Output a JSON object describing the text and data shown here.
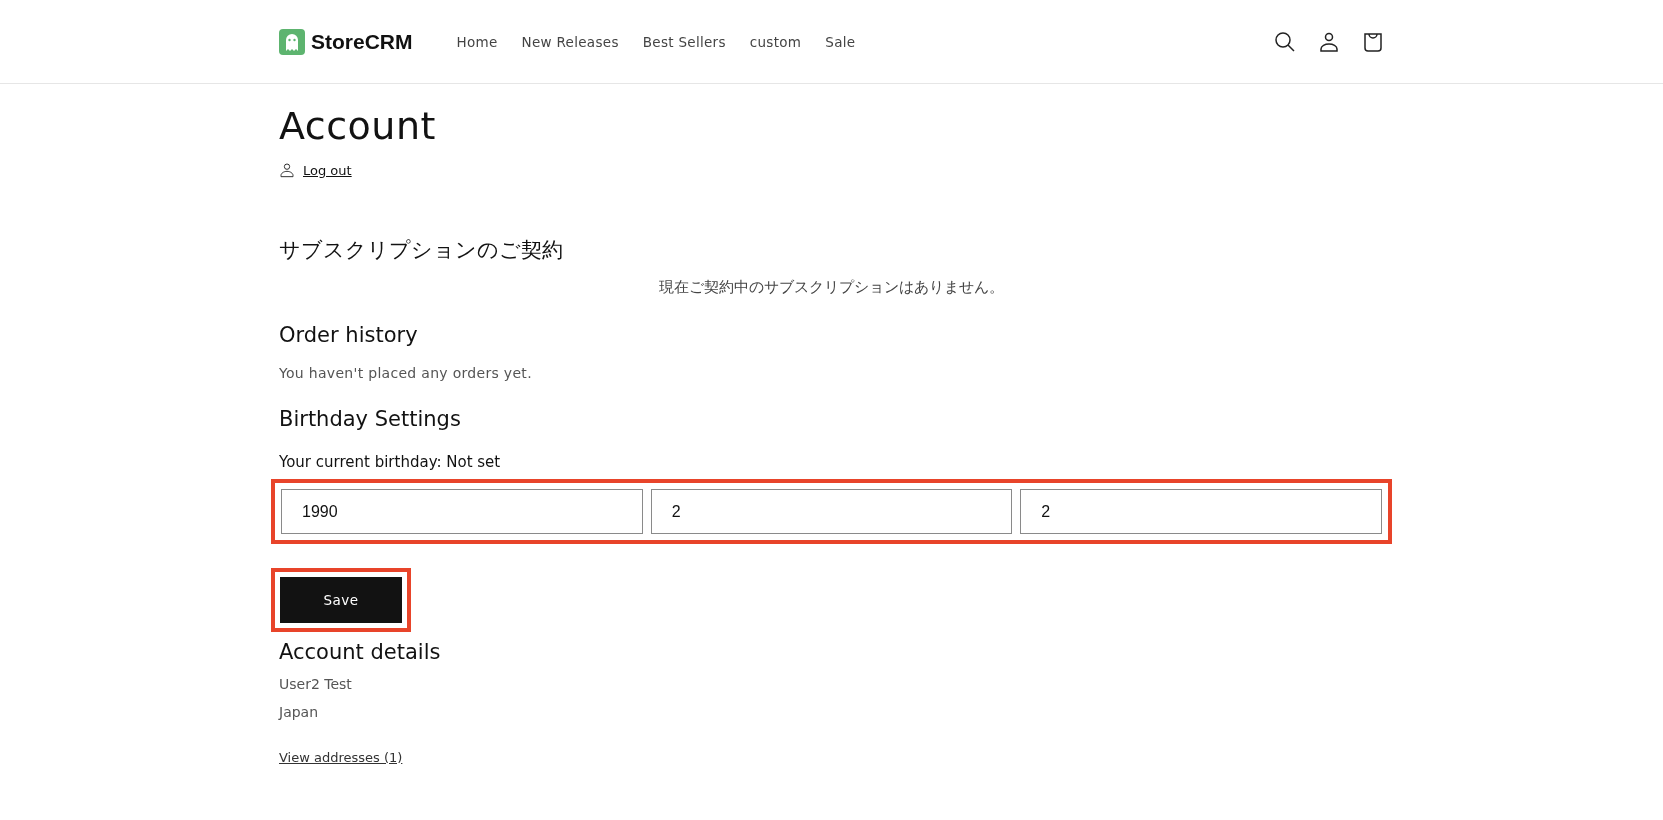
{
  "header": {
    "logo": "StoreCRM",
    "nav": [
      {
        "label": "Home"
      },
      {
        "label": "New Releases"
      },
      {
        "label": "Best Sellers"
      },
      {
        "label": "custom"
      },
      {
        "label": "Sale"
      }
    ]
  },
  "page": {
    "title": "Account",
    "logout": "Log out"
  },
  "subscriptions": {
    "heading": "サブスクリプションのご契約",
    "message": "現在ご契約中のサブスクリプションはありません。"
  },
  "orders": {
    "heading": "Order history",
    "message": "You haven't placed any orders yet."
  },
  "birthday": {
    "heading": "Birthday Settings",
    "current": "Your current birthday: Not set",
    "highlighted": true,
    "fields": [
      {
        "value": "1990"
      },
      {
        "value": "2"
      },
      {
        "value": "2"
      }
    ],
    "save": {
      "label": "Save",
      "highlighted": true
    }
  },
  "account": {
    "heading": "Account details",
    "lines": [
      "User2 Test",
      "Japan"
    ],
    "addresses_link": "View addresses (1)"
  }
}
